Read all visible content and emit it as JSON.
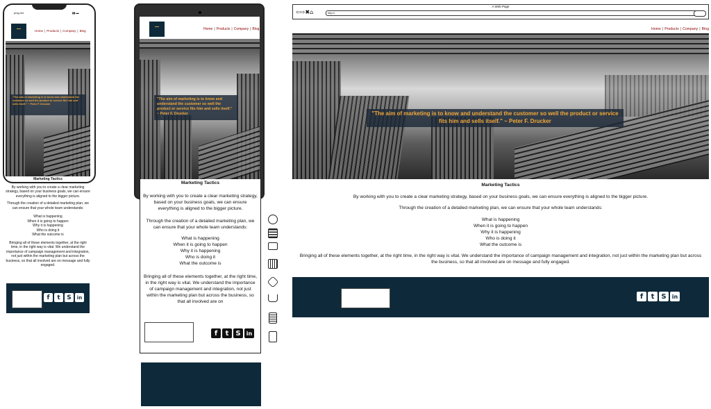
{
  "nav": {
    "items": [
      "Home",
      "Products",
      "Company",
      "Blog"
    ]
  },
  "browser": {
    "title": "A Web Page",
    "url": "http://"
  },
  "phone": {
    "status_left": "pmg.me"
  },
  "quote": "\"The aim of marketing is to know and understand the customer so well the product or service fits him and sells itself.\" ~ Peter F. Drucker",
  "content": {
    "heading": "Marketing Tactics",
    "p1": "By working with you to create a clear marketing strategy,  based on your business goals, we can ensure everything is aligned to the bigger picture.",
    "p2": "Through the creation of a detailed marketing plan, we can ensure that your whole team understands:",
    "list": [
      "What is happening",
      "When it is going to happen",
      "Why it is happening",
      "Who is doing it",
      "What the outcome is"
    ],
    "p3": "Bringing all of these elements together, at the right time, in the right way is vital. We understand the importance of campaign management and integration, not just within the marketing plan but across the business, so that all involved are on message and fully engaged.",
    "p3_tablet": "Bringing all of these elements together, at the right time, in the right way is vital. We understand the importance of campaign management and integration, not just within the marketing plan but across the business, so that all involved are on"
  },
  "social": [
    "f",
    "t",
    "S",
    "in"
  ],
  "colors": {
    "footer": "#0e2a3a",
    "quote_text": "#f2a93b",
    "nav_link": "#8b0000"
  },
  "side_icons": [
    "clock-icon",
    "list-icon",
    "monitor-icon",
    "calendar-icon",
    "hexagon-icon",
    "coffee-icon",
    "building-icon",
    "clipboard-icon"
  ]
}
